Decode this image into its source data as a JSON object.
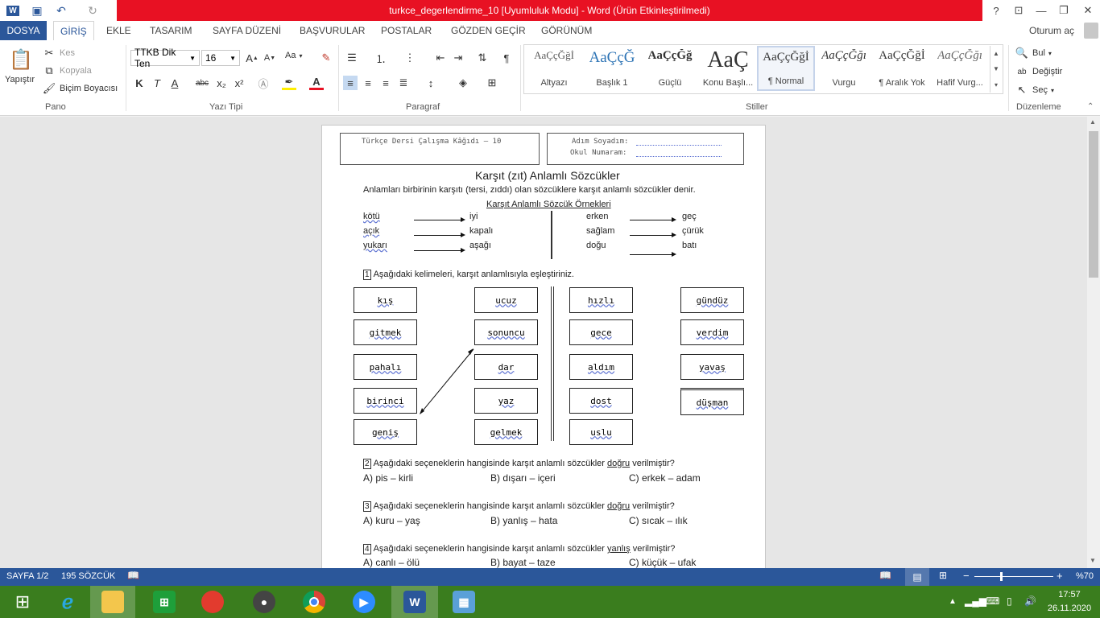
{
  "window": {
    "title": "turkce_degerlendirme_10 [Uyumluluk Modu] - Word (Ürün Etkinleştirilmedi)",
    "help": "?",
    "controls": [
      "⊡",
      "—",
      "❐",
      "✕"
    ]
  },
  "tabs": [
    "DOSYA",
    "GİRİŞ",
    "EKLE",
    "TASARIM",
    "SAYFA DÜZENİ",
    "BAŞVURULAR",
    "POSTALAR",
    "GÖZDEN GEÇİR",
    "GÖRÜNÜM"
  ],
  "signin": "Oturum aç",
  "ribbon": {
    "clipboard": {
      "paste": "Yapıştır",
      "cut": "Kes",
      "copy": "Kopyala",
      "format_painter": "Biçim Boyacısı",
      "label": "Pano"
    },
    "font": {
      "family": "TTKB Dik Ten",
      "size": "16",
      "label": "Yazı Tipi",
      "change_case": "Aa",
      "bold": "K",
      "italic": "T",
      "underline": "A",
      "strike": "abc",
      "sub": "x₂",
      "sup": "x²"
    },
    "paragraph": {
      "label": "Paragraf"
    },
    "styles": {
      "label": "Stiller",
      "items": [
        {
          "sample": "AaÇçĞğİ",
          "name": "Altyazı"
        },
        {
          "sample": "AaÇçĞ",
          "name": "Başlık 1"
        },
        {
          "sample": "AaÇçĞğ",
          "name": "Güçlü"
        },
        {
          "sample": "AaÇ",
          "name": "Konu Başlı..."
        },
        {
          "sample": "AaÇçĞğİ",
          "name": "¶ Normal"
        },
        {
          "sample": "AaÇçĞğı",
          "name": "Vurgu"
        },
        {
          "sample": "AaÇçĞğİ",
          "name": "¶ Aralık Yok"
        },
        {
          "sample": "AaÇçĞğı",
          "name": "Hafif Vurg..."
        }
      ]
    },
    "editing": {
      "find": "Bul",
      "replace": "Değiştir",
      "select": "Seç",
      "label": "Düzenleme"
    }
  },
  "document": {
    "header_left": "Türkçe Dersi Çalışma Kâğıdı – 10",
    "header_name": "Adım Soyadım:",
    "header_number": "Okul Numaram:",
    "title": "Karşıt (zıt) Anlamlı Sözcükler",
    "intro": "Anlamları birbirinin karşıtı (tersi, zıddı) olan sözcüklere karşıt anlamlı sözcükler denir.",
    "examples_heading": "Karşıt Anlamlı Sözcük Örnekleri",
    "examples_left": [
      [
        "kötü",
        "iyi"
      ],
      [
        "açık",
        "kapalı"
      ],
      [
        "yukarı",
        "aşağı"
      ]
    ],
    "examples_right": [
      [
        "erken",
        "geç"
      ],
      [
        "sağlam",
        "çürük"
      ],
      [
        "doğu",
        "batı"
      ]
    ],
    "q1": {
      "num": "1",
      "text": "Aşağıdaki kelimeleri, karşıt anlamlısıyla eşleştiriniz."
    },
    "match_col1": [
      "kış",
      "gitmek",
      "pahalı",
      "birinci",
      "geniş"
    ],
    "match_col2": [
      "ucuz",
      "sonuncu",
      "dar",
      "yaz",
      "gelmek"
    ],
    "match_col3": [
      "hızlı",
      "gece",
      "aldım",
      "dost",
      "uslu"
    ],
    "match_col4": [
      "gündüz",
      "verdim",
      "yavaş",
      "düşman"
    ],
    "q2": {
      "num": "2",
      "pre": "Aşağıdaki seçeneklerin hangisinde karşıt anlamlı sözcükler ",
      "key": "doğru",
      "post": " verilmiştir?",
      "a": "A) pis – kirli",
      "b": "B) dışarı – içeri",
      "c": "C) erkek – adam"
    },
    "q3": {
      "num": "3",
      "pre": "Aşağıdaki seçeneklerin hangisinde karşıt anlamlı sözcükler ",
      "key": "doğru",
      "post": " verilmiştir?",
      "a": "A) kuru – yaş",
      "b": "B) yanlış – hata",
      "c": "C) sıcak – ılık"
    },
    "q4": {
      "num": "4",
      "pre": "Aşağıdaki seçeneklerin hangisinde karşıt anlamlı sözcükler ",
      "key": "yanlış",
      "post": " verilmiştir?",
      "a": "A) canlı – ölü",
      "b": "B) bayat – taze",
      "c": "C) küçük – ufak"
    }
  },
  "status": {
    "page": "SAYFA 1/2",
    "words": "195 SÖZCÜK",
    "zoom": "%70",
    "zoom_minus": "−",
    "zoom_plus": "+"
  },
  "clock": {
    "time": "17:57",
    "date": "26.11.2020"
  },
  "colors": {
    "word_blue": "#2b579a",
    "title_red": "#e81123",
    "taskbar_green": "#3a7d1e"
  }
}
